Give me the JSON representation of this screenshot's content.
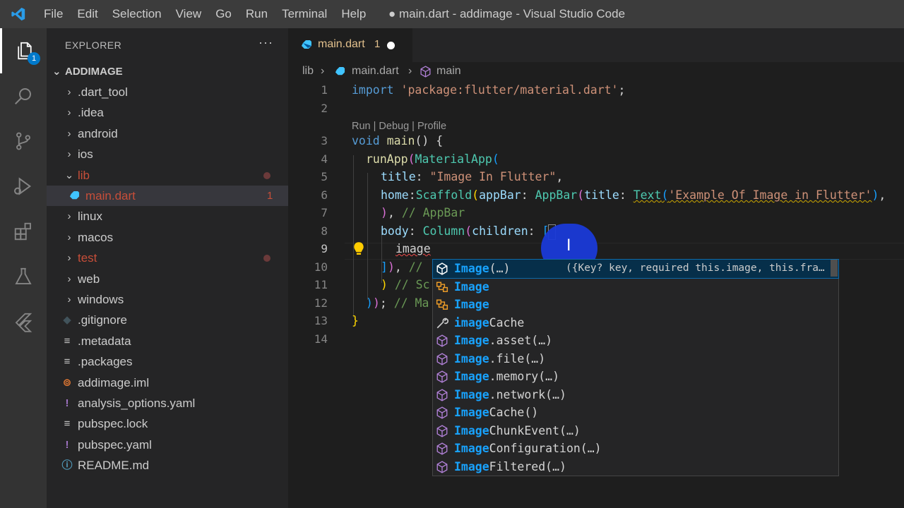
{
  "window": {
    "title": "● main.dart - addimage - Visual Studio Code",
    "menu": [
      "File",
      "Edit",
      "Selection",
      "View",
      "Go",
      "Run",
      "Terminal",
      "Help"
    ]
  },
  "activity_bar": {
    "items": [
      "explorer-icon",
      "search-icon",
      "source-control-icon",
      "run-debug-icon",
      "extensions-icon",
      "testing-icon",
      "flutter-icon"
    ],
    "explorer_badge": "1"
  },
  "explorer": {
    "title": "EXPLORER",
    "more": "···",
    "root": "ADDIMAGE",
    "items": [
      {
        "label": ".dart_tool",
        "type": "folder",
        "expanded": false
      },
      {
        "label": ".idea",
        "type": "folder",
        "expanded": false
      },
      {
        "label": "android",
        "type": "folder",
        "expanded": false
      },
      {
        "label": "ios",
        "type": "folder",
        "expanded": false
      },
      {
        "label": "lib",
        "type": "folder",
        "expanded": true
      },
      {
        "label": "main.dart",
        "type": "dart-file",
        "count": "1"
      },
      {
        "label": "linux",
        "type": "folder",
        "expanded": false
      },
      {
        "label": "macos",
        "type": "folder",
        "expanded": false
      },
      {
        "label": "test",
        "type": "folder",
        "expanded": false
      },
      {
        "label": "web",
        "type": "folder",
        "expanded": false
      },
      {
        "label": "windows",
        "type": "folder",
        "expanded": false
      },
      {
        "label": ".gitignore",
        "type": "git-file"
      },
      {
        "label": ".metadata",
        "type": "text-file"
      },
      {
        "label": ".packages",
        "type": "text-file"
      },
      {
        "label": "addimage.iml",
        "type": "rss-file"
      },
      {
        "label": "analysis_options.yaml",
        "type": "yaml-file"
      },
      {
        "label": "pubspec.lock",
        "type": "text-file"
      },
      {
        "label": "pubspec.yaml",
        "type": "yaml-file"
      },
      {
        "label": "README.md",
        "type": "info-file"
      }
    ]
  },
  "editor": {
    "tab": {
      "label": "main.dart",
      "count": "1"
    },
    "breadcrumbs": [
      "lib",
      "main.dart",
      "main"
    ],
    "codelens": "Run | Debug | Profile",
    "line_numbers": [
      "1",
      "2",
      "3",
      "4",
      "5",
      "6",
      "7",
      "8",
      "9",
      "10",
      "11",
      "12",
      "13",
      "14"
    ],
    "code": {
      "l1_kw": "import",
      "l1_str": "'package:flutter/material.dart'",
      "l1_end": ";",
      "l3_kw": "void",
      "l3_fn": "main",
      "l3_rest": "() {",
      "l4_fn": "runApp",
      "l4_cls": "MaterialApp",
      "l5_par": "title",
      "l5_str": "\"Image In Flutter\"",
      "l6_par1": "home",
      "l6_cls1": "Scaffold",
      "l6_par2": "appBar",
      "l6_cls2": "AppBar",
      "l6_par3": "title",
      "l6_cls3": "Text",
      "l6_str": "'Example Of Image in Flutter'",
      "l7_cm": "// AppBar",
      "l8_par": "body",
      "l8_cls": "Column",
      "l8_par2": "children",
      "l9_typed": "image",
      "l10_cm": "//",
      "l11_cm": "// Sc",
      "l12_cm": "// Ma"
    }
  },
  "suggestions": [
    {
      "label": "Image(…)",
      "match": "Image",
      "icon": "class-constructor-icon",
      "detail": "({Key? key, required this.image, this.fra…"
    },
    {
      "label": "Image",
      "match": "Image",
      "icon": "class-icon"
    },
    {
      "label": "Image",
      "match": "Image",
      "icon": "class-icon"
    },
    {
      "label": "imageCache",
      "match": "image",
      "icon": "property-icon"
    },
    {
      "label": "Image.asset(…)",
      "match": "Image",
      "icon": "class-constructor-icon"
    },
    {
      "label": "Image.file(…)",
      "match": "Image",
      "icon": "class-constructor-icon"
    },
    {
      "label": "Image.memory(…)",
      "match": "Image",
      "icon": "class-constructor-icon"
    },
    {
      "label": "Image.network(…)",
      "match": "Image",
      "icon": "class-constructor-icon"
    },
    {
      "label": "ImageCache()",
      "match": "Image",
      "icon": "class-constructor-icon"
    },
    {
      "label": "ImageChunkEvent(…)",
      "match": "Image",
      "icon": "class-constructor-icon"
    },
    {
      "label": "ImageConfiguration(…)",
      "match": "Image",
      "icon": "class-constructor-icon"
    },
    {
      "label": "ImageFiltered(…)",
      "match": "Image",
      "icon": "class-constructor-icon"
    }
  ],
  "colors": {
    "accent": "#007acc",
    "match_highlight": "#18a3ff",
    "modified": "#e2c08d",
    "error": "#c74e39"
  }
}
